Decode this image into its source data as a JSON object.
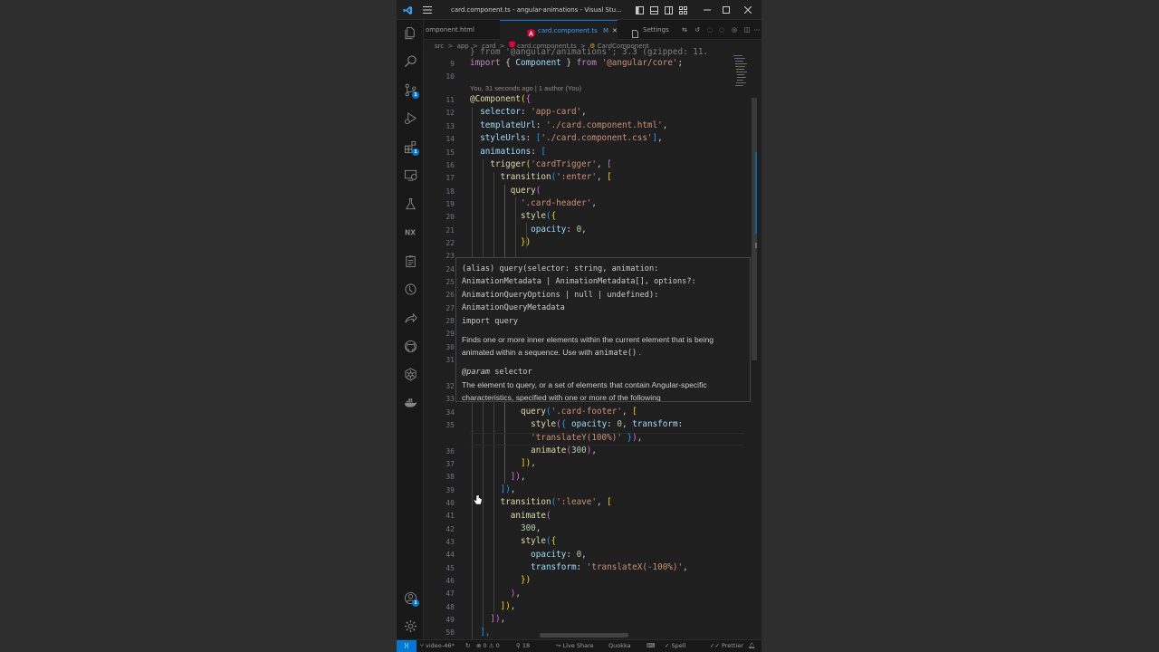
{
  "window": {
    "title": "card.component.ts - angular-animations - Visual Stu..."
  },
  "colors": {
    "accent": "#0078d4",
    "keyword": "#c586c0",
    "string": "#ce9178",
    "function": "#dcdcaa",
    "property": "#9cdcfe",
    "number": "#b5cea8"
  },
  "tabs": [
    {
      "label": "omponent.html",
      "active": false
    },
    {
      "label": "card.component.ts",
      "modified": "M",
      "active": true
    },
    {
      "label": "Settings",
      "active": false
    }
  ],
  "breadcrumb": [
    "src",
    "app",
    "card",
    "card.component.ts",
    "CardComponent"
  ],
  "breadcrumb_sep": ">",
  "activity_icons": [
    "explorer-icon",
    "search-icon",
    "source-control-icon",
    "run-debug-icon",
    "extensions-icon",
    "remote-explorer-icon",
    "testing-icon",
    "nx-icon",
    "clipboard-icon",
    "timeline-icon",
    "live-share-icon",
    "github-icon",
    "kubernetes-icon",
    "docker-icon",
    "account-icon",
    "settings-gear-icon"
  ],
  "badges": {
    "source_control": "1",
    "extensions": "1",
    "account": "1"
  },
  "editor": {
    "blame": "You, 31 seconds ago | 1 author (You)",
    "line_numbers": [
      "9",
      "10",
      "11",
      "12",
      "13",
      "14",
      "15",
      "16",
      "17",
      "18",
      "19",
      "20",
      "21",
      "22",
      "23",
      "24",
      "25",
      "26",
      "27",
      "28",
      "29",
      "30",
      "31",
      "32",
      "33",
      "34",
      "35",
      "",
      "36",
      "37",
      "38",
      "39",
      "40",
      "41",
      "42",
      "43",
      "44",
      "45",
      "46",
      "47",
      "48",
      "49",
      "50"
    ],
    "line_1_partial": "} from '@angular/animations'; 3.3 (gzipped: 11.",
    "lines": {
      "l9": [
        "import",
        " { ",
        "Component",
        " } ",
        "from",
        " ",
        "'@angular/core'",
        ";"
      ],
      "l11": [
        "@",
        "Component",
        "(",
        "{"
      ],
      "l12": [
        "selector",
        ": ",
        "'app-card'",
        ","
      ],
      "l13": [
        "templateUrl",
        ": ",
        "'./card.component.html'",
        ","
      ],
      "l14": [
        "styleUrls",
        ": ",
        "[",
        "'./card.component.css'",
        "]",
        ","
      ],
      "l15": [
        "animations",
        ": ",
        "["
      ],
      "l16": [
        "trigger",
        "(",
        "'cardTrigger'",
        ", ",
        "["
      ],
      "l17": [
        "transition",
        "(",
        "':enter'",
        ", ",
        "["
      ],
      "l18": [
        "query",
        "("
      ],
      "l19": [
        "'.card-header'",
        ","
      ],
      "l20": [
        "style",
        "(",
        "{"
      ],
      "l21": [
        "opacity",
        ": ",
        "0",
        ","
      ],
      "l22": [
        "})"
      ],
      "l34": [
        "query",
        "(",
        "'.card-footer'",
        ", ",
        "["
      ],
      "l35a": [
        "style",
        "(",
        "{ ",
        "opacity",
        ": ",
        "0",
        ", ",
        "transform",
        ":"
      ],
      "l35b": [
        "'translateY(100%)'",
        " }",
        ")",
        ","
      ],
      "l36": [
        "animate",
        "(",
        "300",
        ")",
        ","
      ],
      "l37": [
        "])",
        ","
      ],
      "l38": [
        "])",
        ","
      ],
      "l39": [
        "])",
        ","
      ],
      "l40": [
        "transition",
        "(",
        "':leave'",
        ", ",
        "["
      ],
      "l41": [
        "animate",
        "("
      ],
      "l42": [
        "300",
        ","
      ],
      "l43": [
        "style",
        "(",
        "{"
      ],
      "l44": [
        "opacity",
        ": ",
        "0",
        ","
      ],
      "l45": [
        "transform",
        ": ",
        "'translateX(-100%)'",
        ","
      ],
      "l46": [
        "})"
      ],
      "l47": [
        ")",
        ","
      ],
      "l48": [
        "])",
        ","
      ],
      "l49": [
        "])",
        ","
      ],
      "l50": [
        "],"
      ]
    }
  },
  "hover": {
    "signature": "(alias) query(selector: string, animation:\nAnimationMetadata | AnimationMetadata[], options?:\nAnimationQueryOptions | null | undefined):\nAnimationQueryMetadata\nimport query",
    "description": "Finds one or more inner elements within the current element that is being animated within a sequence. Use with",
    "description_code": "animate()",
    "description_end": ".",
    "param_tag": "@param",
    "param_name": "selector",
    "param_desc": "The element to query, or a set of elements that contain Angular-specific characteristics, specified with one or more of the following"
  },
  "statusbar": {
    "branch": "video-46*",
    "sync": "↻",
    "problems": "⊗ 0 ⚠ 0",
    "ports": "18",
    "live_share": "Live Share",
    "quokka": "Quokka",
    "spell": "Spell",
    "prettier": "Prettier"
  }
}
